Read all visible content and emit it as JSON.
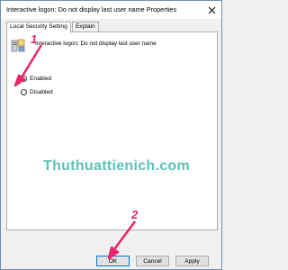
{
  "window": {
    "title": "Interactive logon: Do not display last user name Properties",
    "close_icon": "close-icon"
  },
  "tabs": [
    {
      "label": "Local Security Setting",
      "active": true
    },
    {
      "label": "Explain",
      "active": false
    }
  ],
  "policy": {
    "name": "Interactive logon: Do not display last user name",
    "icon": "policy-computer-icon"
  },
  "options": [
    {
      "label": "Enabled",
      "checked": true
    },
    {
      "label": "Disabled",
      "checked": false
    }
  ],
  "watermark": "Thuthuattienich.com",
  "buttons": {
    "ok": "OK",
    "cancel": "Cancel",
    "apply": "Apply"
  },
  "annotations": [
    {
      "number": "1",
      "color": "#e8256b"
    },
    {
      "number": "2",
      "color": "#e8256b"
    }
  ]
}
